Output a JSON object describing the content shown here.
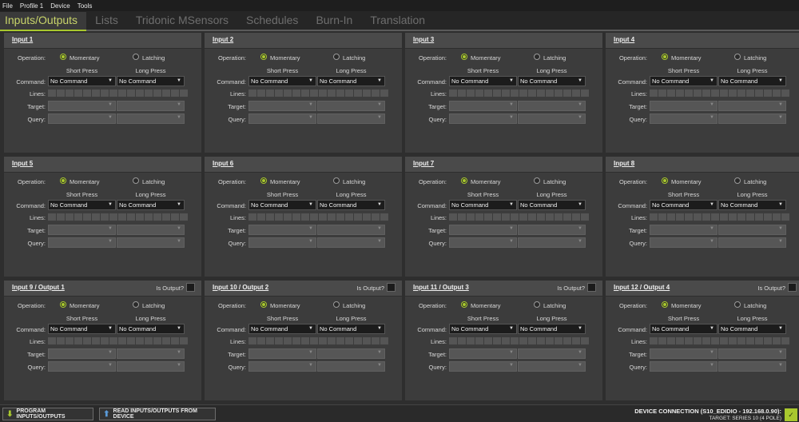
{
  "menu": [
    "File",
    "Profile 1",
    "Device",
    "Tools"
  ],
  "tabs": [
    {
      "label": "Inputs/Outputs",
      "active": true
    },
    {
      "label": "Lists",
      "active": false
    },
    {
      "label": "Tridonic MSensors",
      "active": false
    },
    {
      "label": "Schedules",
      "active": false
    },
    {
      "label": "Burn-In",
      "active": false
    },
    {
      "label": "Translation",
      "active": false
    }
  ],
  "labels": {
    "operation": "Operation:",
    "momentary": "Momentary",
    "latching": "Latching",
    "short_press": "Short Press",
    "long_press": "Long Press",
    "command": "Command:",
    "lines": "Lines:",
    "target": "Target:",
    "query": "Query:",
    "is_output": "Is Output?"
  },
  "panels": [
    {
      "title": "Input 1",
      "operation": "Momentary",
      "short_command": "No Command",
      "long_command": "No Command",
      "has_output": false
    },
    {
      "title": "Input 2",
      "operation": "Momentary",
      "short_command": "No Command",
      "long_command": "No Command",
      "has_output": false
    },
    {
      "title": "Input 3",
      "operation": "Momentary",
      "short_command": "No Command",
      "long_command": "No Command",
      "has_output": false
    },
    {
      "title": "Input 4",
      "operation": "Momentary",
      "short_command": "No Command",
      "long_command": "No Command",
      "has_output": false
    },
    {
      "title": "Input 5",
      "operation": "Momentary",
      "short_command": "No Command",
      "long_command": "No Command",
      "has_output": false
    },
    {
      "title": "Input 6",
      "operation": "Momentary",
      "short_command": "No Command",
      "long_command": "No Command",
      "has_output": false
    },
    {
      "title": "Input 7",
      "operation": "Momentary",
      "short_command": "No Command",
      "long_command": "No Command",
      "has_output": false
    },
    {
      "title": "Input 8",
      "operation": "Momentary",
      "short_command": "No Command",
      "long_command": "No Command",
      "has_output": false
    },
    {
      "title": "Input 9 / Output 1",
      "operation": "Momentary",
      "short_command": "No Command",
      "long_command": "No Command",
      "has_output": true,
      "is_output": false
    },
    {
      "title": "Input 10 / Output 2",
      "operation": "Momentary",
      "short_command": "No Command",
      "long_command": "No Command",
      "has_output": true,
      "is_output": false
    },
    {
      "title": "Input 11 / Output 3",
      "operation": "Momentary",
      "short_command": "No Command",
      "long_command": "No Command",
      "has_output": true,
      "is_output": false
    },
    {
      "title": "Input 12 / Output 4",
      "operation": "Momentary",
      "short_command": "No Command",
      "long_command": "No Command",
      "has_output": true,
      "is_output": false
    }
  ],
  "bottom": {
    "program_label": "PROGRAM INPUTS/OUTPUTS",
    "program_icon": "download-arrow-icon",
    "read_label": "READ INPUTS/OUTPUTS FROM DEVICE",
    "read_icon": "upload-arrow-icon",
    "connection_label": "DEVICE CONNECTION (S10_EDIDIO - 192.168.0.90):",
    "target_label": "TARGET: SERIES 10 (4 POLE)",
    "connection_icon": "connected-device-icon"
  },
  "colors": {
    "accent": "#a9c82e",
    "background": "#2e2e2e",
    "panel": "#3c3c3c"
  }
}
